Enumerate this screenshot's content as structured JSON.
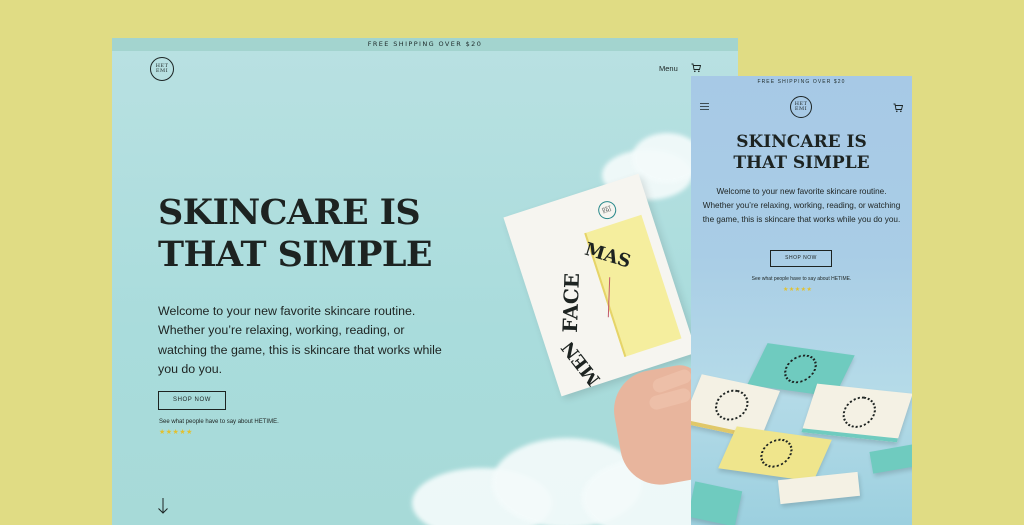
{
  "desktop": {
    "banner": "FREE SHIPPING OVER $20",
    "logo_text": "HET\nEMI",
    "menu_label": "Menu",
    "title_line1": "SKINCARE IS",
    "title_line2": "THAT SIMPLE",
    "body": "Welcome to your new favorite skincare routine. Whether you’re relaxing, working, reading, or watching the game, this is skincare that works while you do you.",
    "shop_button": "SHOP NOW",
    "review_text": "See what people have to say about HETIME.",
    "stars": "★★★★★",
    "package_text_1": "FACE",
    "package_text_2": "MAS",
    "package_text_3": "MEN"
  },
  "mobile": {
    "banner": "FREE SHIPPING OVER $20",
    "logo_text": "HET\nEMI",
    "title_line1": "SKINCARE IS",
    "title_line2": "THAT SIMPLE",
    "body": "Welcome to your new favorite skincare routine. Whether you’re relaxing, working, reading, or watching the game, this is skincare that works while you do you.",
    "shop_button": "SHOP NOW",
    "review_text": "See what people have to say about HETIME.",
    "stars": "★★★★★"
  },
  "icons": {
    "logo": "brand-logo-icon",
    "cart": "cart-icon",
    "menu": "hamburger-icon",
    "arrow": "arrow-down-icon"
  },
  "colors": {
    "page_background": "#e0dc84",
    "desktop_background": "#b0dfdf",
    "mobile_background": "#a9cde6",
    "ink": "#1d2321",
    "stars": "#e2c12f"
  }
}
